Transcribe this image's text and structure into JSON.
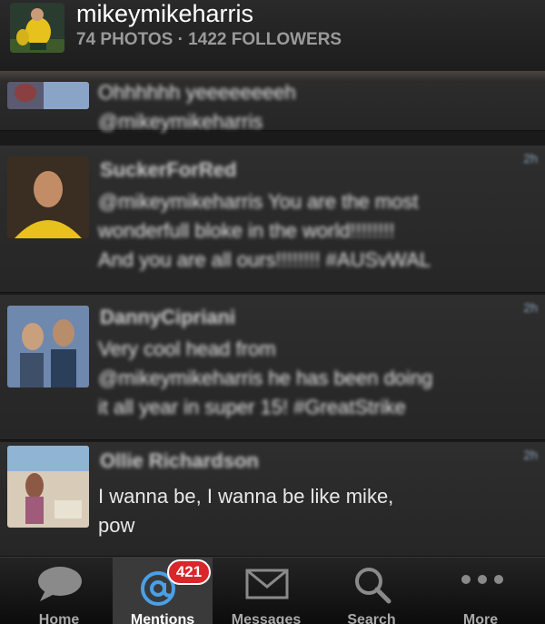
{
  "profile": {
    "username": "mikeymikeharris",
    "stats": "74 PHOTOS · 1422 FOLLOWERS"
  },
  "tweets": [
    {
      "name": "",
      "text": [
        "Ohhhhhh yeeeeeeeeh",
        "@mikeymikeharris"
      ],
      "time": ""
    },
    {
      "name": "SuckerForRed",
      "text": [
        "@mikeymikeharris You are the most",
        "wonderfull bloke in the world!!!!!!!!",
        "And you are all ours!!!!!!!! #AUSvWAL"
      ],
      "time": "2h"
    },
    {
      "name": "DannyCipriani",
      "text": [
        "Very cool head from",
        "@mikeymikeharris he has been doing",
        "it all year in super 15! #GreatStrike"
      ],
      "time": "2h"
    },
    {
      "name": "Ollie Richardson",
      "text": [
        "I wanna be, I wanna be like mike,",
        "pow"
      ],
      "time": "2h"
    }
  ],
  "tabs": [
    {
      "label": "Home",
      "icon": "speech-bubble-icon"
    },
    {
      "label": "Mentions",
      "icon": "at-sign-icon",
      "badge": "421"
    },
    {
      "label": "Messages",
      "icon": "envelope-icon"
    },
    {
      "label": "Search",
      "icon": "magnifier-icon"
    },
    {
      "label": "More",
      "icon": "more-dots-icon"
    }
  ]
}
